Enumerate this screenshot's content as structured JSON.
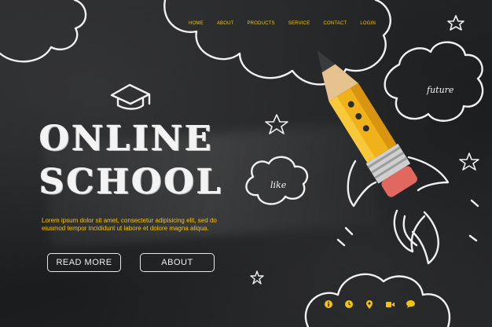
{
  "nav": {
    "items": [
      {
        "label": "HOME"
      },
      {
        "label": "ABOUT"
      },
      {
        "label": "PRODUCTS"
      },
      {
        "label": "SERVICE"
      },
      {
        "label": "CONTACT"
      },
      {
        "label": "LOGIN"
      }
    ]
  },
  "hero": {
    "title_line1": "ONLINE",
    "title_line2": "SCHOOL",
    "description": "Lorem ipsum dolor sit amet, consectetur adipisicing elit, sed do eiusmod tempor incididunt ut labore et dolore magna aliqua.",
    "read_more_label": "READ MORE",
    "about_label": "ABOUT"
  },
  "doodles": {
    "future_word": "future",
    "like_word": "like"
  },
  "social": {
    "icons": [
      "info-icon",
      "clock-icon",
      "location-icon",
      "video-icon",
      "chat-icon"
    ]
  },
  "colors": {
    "accent": "#f2c316",
    "board": "#1e1f21",
    "chalk": "#f2f2f2"
  }
}
